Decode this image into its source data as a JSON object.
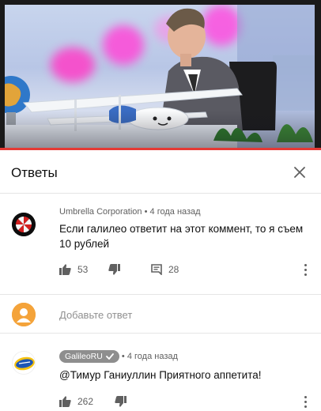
{
  "panel": {
    "title": "Ответы"
  },
  "comments": [
    {
      "author": "Umbrella Corporation",
      "time": "4 года назад",
      "text": "Если галилео ответит на этот коммент, то я съем 10 рублей",
      "likes": "53",
      "replies": "28"
    }
  ],
  "add_reply": {
    "placeholder": "Добавьте ответ"
  },
  "replies": [
    {
      "author": "GalileoRU",
      "verified": true,
      "time": "4 года назад",
      "text": "@Тимур Ганиуллин Приятного аппетита!",
      "likes": "262"
    }
  ],
  "colors": {
    "progress": "#e53935",
    "avatar_orange": "#f4a33a",
    "badge": "#8e8e8e"
  }
}
